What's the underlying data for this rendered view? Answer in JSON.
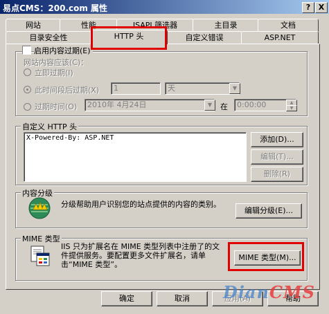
{
  "window": {
    "title": "易点CMS：200.com 属性",
    "help_button": "?",
    "close_button": "X"
  },
  "tabs": {
    "row1": [
      "网站",
      "性能",
      "ISAPI 筛选器",
      "主目录",
      "文档"
    ],
    "row2": [
      "目录安全性",
      "HTTP 头",
      "自定义错误",
      "ASP.NET"
    ],
    "active": "HTTP 头"
  },
  "content_expiration": {
    "enable_label": "启用内容过期(E)",
    "enabled": false,
    "section_label": "网站内容应该(C)：",
    "expire_now": "立即过期(I)",
    "expire_after": "此时间段后过期(X)",
    "expire_after_value": "1",
    "expire_after_unit": "天",
    "expire_on": "过期时间(O)",
    "expire_on_date": "2010年 4月24日",
    "at_label": "在",
    "expire_on_time": "0:00:00"
  },
  "custom_headers": {
    "label": "自定义 HTTP 头",
    "items": [
      "X-Powered-By: ASP.NET"
    ],
    "add_button": "添加(D)...",
    "edit_button": "编辑(T)...",
    "remove_button": "删除(R)"
  },
  "content_rating": {
    "label": "内容分级",
    "description": "分级帮助用户识别您的站点提供的内容的类别。",
    "edit_button": "编辑分级(E)...",
    "icon": "rating-icon"
  },
  "mime": {
    "label": "MIME 类型",
    "description": "IIS 只为扩展名在 MIME 类型列表中注册了的文件提供服务。要配置更多文件扩展名，请单击“MIME 类型”。",
    "button": "MIME 类型(M)...",
    "icon": "mime-icon"
  },
  "footer": {
    "ok": "确定",
    "cancel": "取消",
    "apply": "应用(A)",
    "help": "帮助"
  },
  "watermark": "DianCMS",
  "colors": {
    "title_start": "#0a246a",
    "title_end": "#a6caf0",
    "highlight_red": "#e00000",
    "dialog_bg": "#d4d0c8"
  }
}
